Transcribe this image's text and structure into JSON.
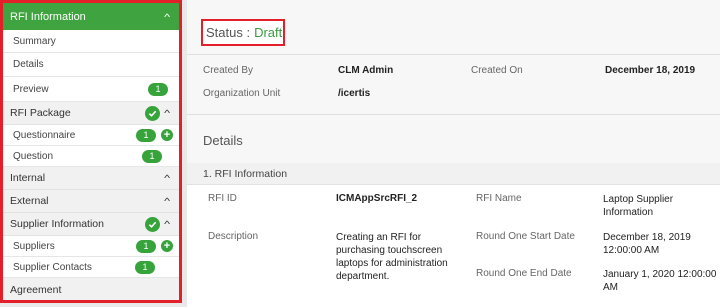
{
  "sidebar": {
    "header": "RFI Information",
    "items_top": [
      {
        "label": "Summary"
      },
      {
        "label": "Details"
      },
      {
        "label": "Preview",
        "count": "1"
      }
    ],
    "rfi_package": {
      "label": "RFI Package",
      "items": [
        {
          "label": "Questionnaire",
          "count": "1"
        },
        {
          "label": "Question",
          "count": "1"
        }
      ]
    },
    "internal": {
      "label": "Internal"
    },
    "external": {
      "label": "External"
    },
    "supplier_information": {
      "label": "Supplier Information",
      "items": [
        {
          "label": "Suppliers",
          "count": "1"
        },
        {
          "label": "Supplier Contacts",
          "count": "1"
        }
      ]
    },
    "agreement": {
      "label": "Agreement"
    }
  },
  "main": {
    "status_label": "Status :",
    "status_value": "Draft",
    "created_by_label": "Created By",
    "created_by_value": "CLM Admin",
    "created_on_label": "Created On",
    "created_on_value": "December 18, 2019",
    "org_unit_label": "Organization Unit",
    "org_unit_value": "/icertis",
    "details_heading": "Details",
    "section_title": "1. RFI Information",
    "rfi_id_label": "RFI ID",
    "rfi_id_value": "ICMAppSrcRFI_2",
    "rfi_name_label": "RFI Name",
    "rfi_name_value_1": "Laptop Supplier",
    "rfi_name_value_2": "Information",
    "description_label": "Description",
    "description_1": "Creating an RFI for",
    "description_2": "purchasing touchscreen",
    "description_3": "laptops for administration",
    "description_4": "department.",
    "round_start_label": "Round One Start Date",
    "round_start_1": "December 18, 2019",
    "round_start_2": "12:00:00 AM",
    "round_end_label": "Round One End Date",
    "round_end_1": "January 1, 2020 12:00:00",
    "round_end_2": "AM"
  },
  "colors": {
    "accent": "#3fa43f",
    "highlight": "#e3202a"
  }
}
